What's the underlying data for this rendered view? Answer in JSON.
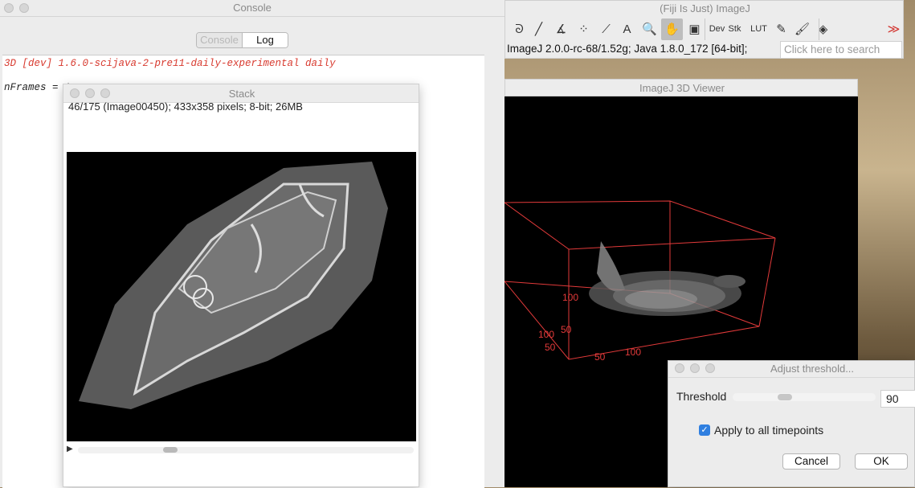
{
  "console": {
    "title": "Console",
    "tabs": [
      {
        "label": "Console",
        "active": false
      },
      {
        "label": "Log",
        "active": true
      }
    ],
    "lines": [
      "3D [dev] 1.6.0-scijava-2-pre11-daily-experimental daily",
      "nFrames = 1"
    ]
  },
  "stack": {
    "title": "Stack",
    "info": "46/175 (Image00450); 433x358 pixels; 8-bit; 26MB",
    "play_glyph": "▶"
  },
  "imagej": {
    "title": "(Fiji Is Just) ImageJ",
    "tools": [
      {
        "name": "freehand-selection-icon",
        "glyph": "ᘐ"
      },
      {
        "name": "line-tool-icon",
        "glyph": "╱"
      },
      {
        "name": "angle-tool-icon",
        "glyph": "∡"
      },
      {
        "name": "multipoint-tool-icon",
        "glyph": "⁘"
      },
      {
        "name": "wand-tool-icon",
        "glyph": "⟋"
      },
      {
        "name": "text-tool-icon",
        "glyph": "A"
      },
      {
        "name": "magnifier-tool-icon",
        "glyph": "🔍"
      },
      {
        "name": "hand-tool-icon",
        "glyph": "✋"
      },
      {
        "name": "color-picker-icon",
        "glyph": "▣"
      },
      {
        "name": "dev-menu-icon",
        "glyph": "Dev"
      },
      {
        "name": "stk-menu-icon",
        "glyph": "Stk"
      },
      {
        "name": "lut-menu-icon",
        "glyph": "LUT"
      },
      {
        "name": "pencil-tool-icon",
        "glyph": "✎"
      },
      {
        "name": "brush-tool-icon",
        "glyph": "🖌"
      },
      {
        "name": "flood-fill-icon",
        "glyph": "◈"
      },
      {
        "name": "more-tools-icon",
        "glyph": "≫"
      }
    ],
    "status": "ImageJ 2.0.0-rc-68/1.52g; Java 1.8.0_172 [64-bit];",
    "search_placeholder": "Click here to search"
  },
  "viewer": {
    "title": "ImageJ 3D Viewer",
    "axis_labels": [
      "100",
      "50",
      "100",
      "50",
      "50",
      "100"
    ]
  },
  "threshold": {
    "title": "Adjust threshold...",
    "label": "Threshold",
    "value": "90",
    "slider_fraction": 0.35,
    "checkbox_label": "Apply to all timepoints",
    "checked": true,
    "cancel_label": "Cancel",
    "ok_label": "OK"
  }
}
